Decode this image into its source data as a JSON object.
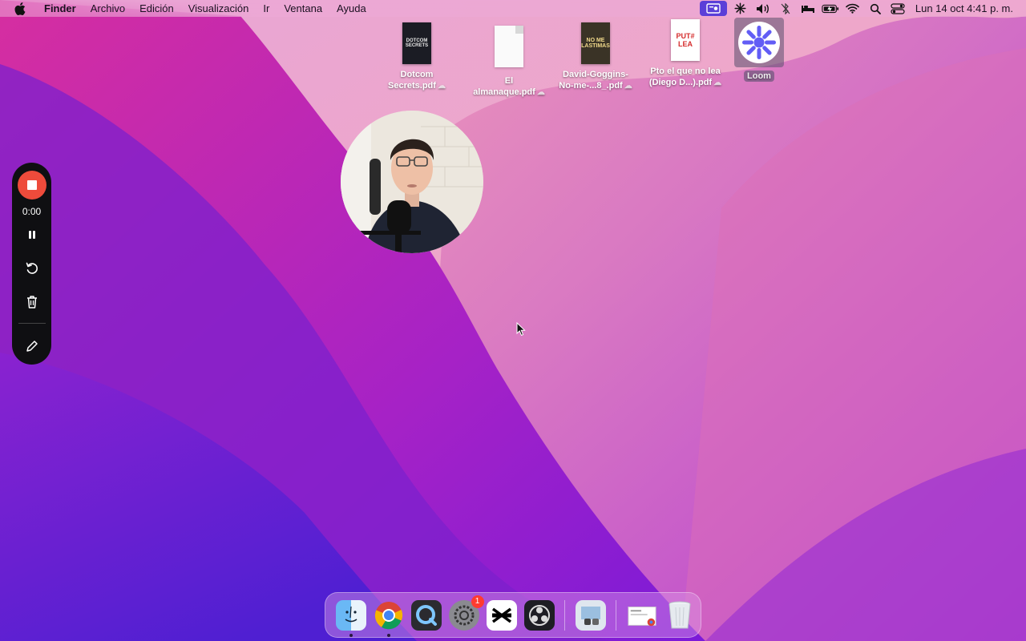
{
  "menubar": {
    "app_name": "Finder",
    "menus": [
      "Archivo",
      "Edición",
      "Visualización",
      "Ir",
      "Ventana",
      "Ayuda"
    ],
    "status_icons": [
      "screen-record-icon",
      "loom-status-icon",
      "volume-icon",
      "bluetooth-icon",
      "sleep-icon",
      "battery-icon",
      "wifi-icon",
      "spotlight-icon",
      "control-center-icon"
    ],
    "clock": "Lun 14 oct  4:41 p. m."
  },
  "desktop": {
    "items": [
      {
        "label_line1": "Dotcom",
        "label_line2": "Secrets.pdf",
        "cover_text": "DOTCOM SECRETS"
      },
      {
        "label_line1": "El",
        "label_line2": "almanaque.pdf"
      },
      {
        "label_line1": "David-Goggins-",
        "label_line2": "No-me-...8_.pdf",
        "cover_text": "NO ME LASTIMAS"
      },
      {
        "label_line1": "Pto el que no lea",
        "label_line2": "(Diego D...).pdf",
        "cover_text": "PUT# LEA"
      },
      {
        "label_line1": "Loom"
      }
    ]
  },
  "recorder": {
    "timer": "0:00"
  },
  "dock": {
    "settings_badge": "1"
  },
  "colors": {
    "accent": "#5b3fd8",
    "record": "#ee4b3b",
    "loom": "#625df5"
  }
}
